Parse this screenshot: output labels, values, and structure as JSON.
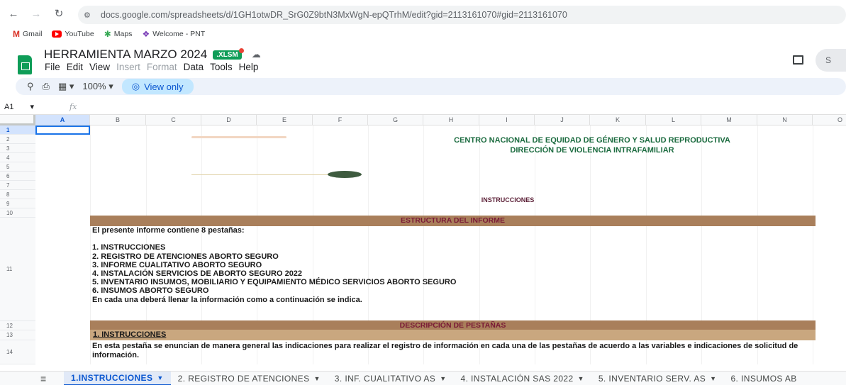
{
  "browser": {
    "url": "docs.google.com/spreadsheets/d/1GH1otwDR_SrG0Z9btN3MxWgN-epQTrhM/edit?gid=2113161070#gid=2113161070",
    "bookmarks": [
      {
        "label": "Gmail",
        "icon": "gmail-icon"
      },
      {
        "label": "YouTube",
        "icon": "youtube-icon"
      },
      {
        "label": "Maps",
        "icon": "maps-icon"
      },
      {
        "label": "Welcome - PNT",
        "icon": "pnt-icon"
      }
    ]
  },
  "doc": {
    "title": "HERRAMIENTA MARZO 2024",
    "badge": ".XLSM",
    "menus": [
      "File",
      "Edit",
      "View",
      "Insert",
      "Format",
      "Data",
      "Tools",
      "Help"
    ],
    "share_label": "S"
  },
  "toolbar": {
    "zoom": "100%",
    "view_only": "View only"
  },
  "formula_bar": {
    "cell_ref": "A1",
    "fx": "fx"
  },
  "grid": {
    "columns": [
      "A",
      "B",
      "C",
      "D",
      "E",
      "F",
      "G",
      "H",
      "I",
      "J",
      "K",
      "L",
      "M",
      "N",
      "O"
    ],
    "rows": [
      "1",
      "2",
      "3",
      "4",
      "5",
      "6",
      "7",
      "8",
      "9",
      "10",
      "11",
      "12",
      "13",
      "14"
    ]
  },
  "sheet": {
    "title_line1": "CENTRO NACIONAL DE EQUIDAD DE GÉNERO Y SALUD REPRODUCTIVA",
    "title_line2": "DIRECCIÓN DE VIOLENCIA INTRAFAMILIAR",
    "instrucciones": "INSTRUCCIONES",
    "estructura_header": "ESTRUCTURA DEL INFORME",
    "estructura_body": "El presente informe contiene 8 pestañas:\n\n1. INSTRUCCIONES\n2. REGISTRO DE ATENCIONES ABORTO SEGURO\n3. INFORME CUALITATIVO ABORTO SEGURO\n4. INSTALACIÓN SERVICIOS DE ABORTO SEGURO 2022\n5. INVENTARIO INSUMOS, MOBILIARIO Y EQUIPAMIENTO MÉDICO SERVICIOS ABORTO SEGURO\n6. INSUMOS ABORTO SEGURO\nEn cada una deberá llenar la información como a continuación se indica.",
    "descripcion_header": "DESCRIPCIÓN DE PESTAÑAS",
    "section1": "1. INSTRUCCIONES",
    "section1_body": "En esta pestaña se enuncian de manera general las indicaciones para realizar el registro de información en cada una de las pestañas de acuerdo a las variables e indicaciones de solicitud de información."
  },
  "tabs": [
    {
      "label": "1.INSTRUCCIONES",
      "active": true
    },
    {
      "label": "2. REGISTRO DE ATENCIONES",
      "active": false
    },
    {
      "label": "3. INF. CUALITATIVO AS",
      "active": false
    },
    {
      "label": "4. INSTALACIÓN SAS 2022",
      "active": false
    },
    {
      "label": "5. INVENTARIO SERV. AS",
      "active": false
    },
    {
      "label": "6. INSUMOS AB",
      "active": false
    }
  ],
  "colors": {
    "accent": "#0b57d0",
    "band_dark": "#a97f5b",
    "band_light": "#c9a77f",
    "title_green": "#1b6b3f",
    "band_text": "#7a1a36"
  }
}
